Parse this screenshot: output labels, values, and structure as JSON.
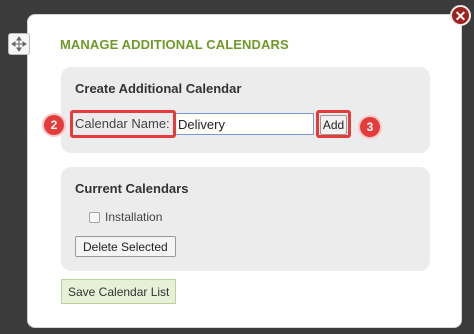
{
  "dialog": {
    "title": "MANAGE ADDITIONAL CALENDARS",
    "close_icon": "close-icon",
    "move_icon": "move-icon"
  },
  "create_panel": {
    "heading": "Create Additional Calendar",
    "name_label": "Calendar Name:",
    "name_value": "Delivery",
    "add_label": "Add"
  },
  "current_panel": {
    "heading": "Current Calendars",
    "calendars": [
      {
        "label": "Installation",
        "checked": false
      }
    ],
    "delete_label": "Delete Selected"
  },
  "save_label": "Save Calendar List",
  "annotations": {
    "badge_2": "2",
    "badge_3": "3"
  },
  "colors": {
    "title": "#6f9a2a",
    "highlight": "#e63b3b",
    "close": "#a0221e",
    "save_bg": "#e6f1d8"
  }
}
